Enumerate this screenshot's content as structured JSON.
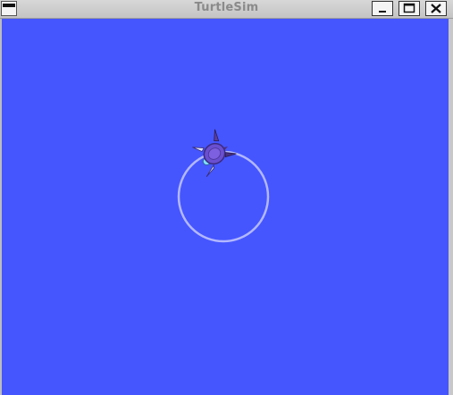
{
  "window": {
    "title": "TurtleSim",
    "controls": {
      "system_menu": "window-menu-icon",
      "minimize": "minimize-icon",
      "maximize": "maximize-icon",
      "close": "close-icon"
    }
  },
  "canvas": {
    "background_color": "#4556ff",
    "pen_color": "#b3b8ff",
    "turtle_shell_color": "#6a4fd0",
    "turtle_icon": "turtle-icon"
  }
}
